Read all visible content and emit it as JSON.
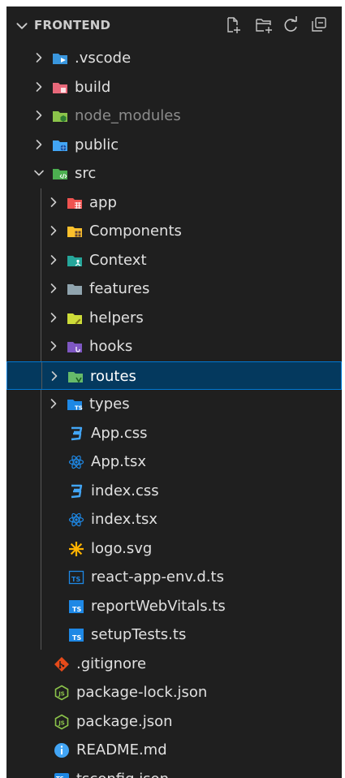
{
  "explorer": {
    "title": "FRONTEND",
    "actions": [
      {
        "name": "new-file-icon",
        "title": "New File..."
      },
      {
        "name": "new-folder-icon",
        "title": "New Folder..."
      },
      {
        "name": "refresh-icon",
        "title": "Refresh Explorer"
      },
      {
        "name": "collapse-all-icon",
        "title": "Collapse Folders in Explorer"
      }
    ]
  },
  "tree": [
    {
      "label": ".vscode",
      "type": "folder",
      "depth": 0,
      "expanded": false,
      "icon": "vscode-folder-icon",
      "color": "#3a96dd"
    },
    {
      "label": "build",
      "type": "folder",
      "depth": 0,
      "expanded": false,
      "icon": "build-folder-icon",
      "color": "#e8697a"
    },
    {
      "label": "node_modules",
      "type": "folder",
      "depth": 0,
      "expanded": false,
      "icon": "node-modules-folder-icon",
      "color": "#8bc34a",
      "dim": true
    },
    {
      "label": "public",
      "type": "folder",
      "depth": 0,
      "expanded": false,
      "icon": "public-folder-icon",
      "color": "#42a5f5"
    },
    {
      "label": "src",
      "type": "folder",
      "depth": 0,
      "expanded": true,
      "icon": "src-folder-icon",
      "color": "#4caf50"
    },
    {
      "label": "app",
      "type": "folder",
      "depth": 1,
      "expanded": false,
      "icon": "app-folder-icon",
      "color": "#ef5350"
    },
    {
      "label": "Components",
      "type": "folder",
      "depth": 1,
      "expanded": false,
      "icon": "components-folder-icon",
      "color": "#fbc02d"
    },
    {
      "label": "Context",
      "type": "folder",
      "depth": 1,
      "expanded": false,
      "icon": "context-folder-icon",
      "color": "#26a69a"
    },
    {
      "label": "features",
      "type": "folder",
      "depth": 1,
      "expanded": false,
      "icon": "folder-icon",
      "color": "#90a4ae"
    },
    {
      "label": "helpers",
      "type": "folder",
      "depth": 1,
      "expanded": false,
      "icon": "helpers-folder-icon",
      "color": "#cddc39"
    },
    {
      "label": "hooks",
      "type": "folder",
      "depth": 1,
      "expanded": false,
      "icon": "hooks-folder-icon",
      "color": "#7e57c2"
    },
    {
      "label": "routes",
      "type": "folder",
      "depth": 1,
      "expanded": false,
      "icon": "routes-folder-icon",
      "color": "#66bb6a",
      "selected": true
    },
    {
      "label": "types",
      "type": "folder",
      "depth": 1,
      "expanded": false,
      "icon": "types-folder-icon",
      "color": "#1e88e5"
    },
    {
      "label": "App.css",
      "type": "file",
      "depth": 1,
      "icon": "css-file-icon",
      "color": "#42a5f5"
    },
    {
      "label": "App.tsx",
      "type": "file",
      "depth": 1,
      "icon": "react-file-icon",
      "color": "#1e88e5"
    },
    {
      "label": "index.css",
      "type": "file",
      "depth": 1,
      "icon": "css-file-icon",
      "color": "#42a5f5"
    },
    {
      "label": "index.tsx",
      "type": "file",
      "depth": 1,
      "icon": "react-file-icon",
      "color": "#1e88e5"
    },
    {
      "label": "logo.svg",
      "type": "file",
      "depth": 1,
      "icon": "svg-file-icon",
      "color": "#ffb300"
    },
    {
      "label": "react-app-env.d.ts",
      "type": "file",
      "depth": 1,
      "icon": "ts-definition-file-icon",
      "color": "#1e88e5"
    },
    {
      "label": "reportWebVitals.ts",
      "type": "file",
      "depth": 1,
      "icon": "typescript-file-icon",
      "color": "#1e88e5"
    },
    {
      "label": "setupTests.ts",
      "type": "file",
      "depth": 1,
      "icon": "typescript-file-icon",
      "color": "#1e88e5"
    },
    {
      "label": ".gitignore",
      "type": "file",
      "depth": 0,
      "icon": "git-file-icon",
      "color": "#e64a19"
    },
    {
      "label": "package-lock.json",
      "type": "file",
      "depth": 0,
      "icon": "npm-file-icon",
      "color": "#8bc34a"
    },
    {
      "label": "package.json",
      "type": "file",
      "depth": 0,
      "icon": "npm-file-icon",
      "color": "#8bc34a"
    },
    {
      "label": "README.md",
      "type": "file",
      "depth": 0,
      "icon": "info-file-icon",
      "color": "#42a5f5"
    },
    {
      "label": "tsconfig.json",
      "type": "file",
      "depth": 0,
      "icon": "tsconfig-file-icon",
      "color": "#1e88e5"
    }
  ],
  "colors": {
    "background": "#1f1f1f",
    "selection_bg": "#04395e",
    "selection_border": "#0078d4",
    "text": "#cccccc",
    "indent_guide": "#585858"
  }
}
